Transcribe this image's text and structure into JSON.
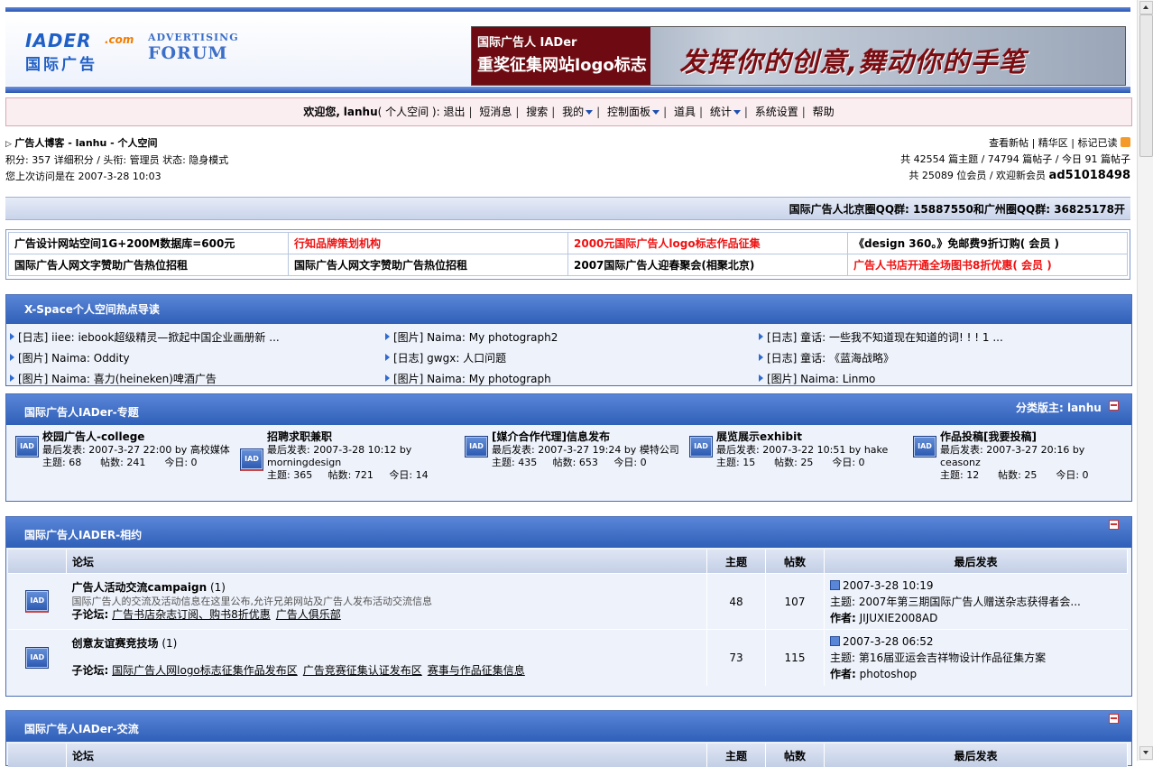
{
  "header": {
    "logo_text": "IADER",
    "logo_dotcom": ".com",
    "logo_cn": "国际广告",
    "tag_a": "ADVERTISING",
    "tag_b": "FORUM",
    "banner_t1": "国际广告人 IADer",
    "banner_t2": "重奖征集网站logo标志",
    "banner_slogan": "发挥你的创意,舞动你的手笔"
  },
  "nav": {
    "welcome": "欢迎您,",
    "user": "lanhu",
    "space": "( 个人空间 ):",
    "items": [
      "退出",
      "短消息",
      "搜索",
      "我的",
      "控制面板",
      "道具",
      "统计",
      "系统设置",
      "帮助"
    ]
  },
  "info": {
    "breadcrumb": "广告人博客 - lanhu  - 个人空间",
    "line2": "积分: 357 详细积分 / 头衔: 管理员 状态: 隐身模式",
    "line3": "您上次访问是在 2007-3-28 10:03",
    "right1_links": [
      "查看新帖",
      "精华区",
      "标记已读"
    ],
    "right2": "共 42554 篇主题 / 74794 篇帖子 / 今日 91 篇帖子",
    "right3_prefix": "共 25089 位会员 / 欢迎新会员",
    "right3_member": "ad51018498"
  },
  "qq": "国际广告人北京圈QQ群: 15887550和广州圈QQ群: 36825178开",
  "ads": [
    [
      "广告设计网站空间1G+200M数据库=600元",
      "行知品牌策划机构",
      "2000元国际广告人logo标志作品征集",
      "《design 360。》免邮费9折订购( 会员 )"
    ],
    [
      "国际广告人网文字赞助广告热位招租",
      "国际广告人网文字赞助广告热位招租",
      "2007国际广告人迎春聚会(相聚北京)",
      "广告人书店开通全场图书8折优惠( 会员 )"
    ]
  ],
  "ads_red": [
    [
      false,
      true,
      true,
      false
    ],
    [
      false,
      false,
      false,
      true
    ]
  ],
  "xspace": {
    "title": "X-Space个人空间热点导读",
    "items": [
      "[日志] iiee: iebook超级精灵—掀起中国企业画册新 ...",
      "[图片] Naima: My photograph2",
      "[日志] 童话: 一些我不知道现在知道的词! ! ! 1 ...",
      "[图片] Naima: Oddity",
      "[日志] gwgx: 人口问题",
      "[日志] 童话: 《蓝海战略》",
      "[图片] Naima: 喜力(heineken)啤酒广告",
      "[图片] Naima: My photograph",
      "[图片] Naima: Linmo"
    ]
  },
  "cat1": {
    "title": "国际广告人IADer-专题",
    "moderator_label": "分类版主:",
    "moderator": "lanhu",
    "forums": [
      {
        "name": "校园广告人-college",
        "last": "最后发表: 2007-3-27 22:00 by 高校媒体",
        "stats": "主题: 68      帖数: 241      今日: 0"
      },
      {
        "name": "招聘求职兼职",
        "last": "最后发表: 2007-3-28 10:12 by morningdesign",
        "stats": "主题: 365     帖数: 721     今日: 14"
      },
      {
        "name": "[媒介合作代理]信息发布",
        "last": "最后发表: 2007-3-27 19:24 by 模特公司",
        "stats": "主题: 435     帖数: 653     今日: 0"
      },
      {
        "name": "展览展示exhibit",
        "last": "最后发表: 2007-3-22 10:51 by hake",
        "stats": "主题: 15      帖数: 25      今日: 0"
      },
      {
        "name": "作品投稿[我要投稿]",
        "last": "最后发表: 2007-3-27 20:16 by ceasonz",
        "stats": "主题: 12      帖数: 25      今日: 0"
      }
    ]
  },
  "cat2": {
    "title": "国际广告人IADER-相约",
    "cols": [
      "论坛",
      "主题",
      "帖数",
      "最后发表"
    ],
    "rows": [
      {
        "name": "广告人活动交流campaign",
        "count": "(1)",
        "desc": "国际广告人的交流及活动信息在这里公布,允许兄弟网站及广告人发布活动交流信息",
        "sub_label": "子论坛:",
        "subs": [
          "广告书店杂志订阅、购书8折优惠",
          "广告人俱乐部"
        ],
        "topics": "48",
        "posts": "107",
        "last_date": "2007-3-28 10:19",
        "last_topic": "主题: 2007年第三期国际广告人赠送杂志获得者会...",
        "last_author_label": "作者:",
        "last_author": "JIJUXIE2008AD"
      },
      {
        "name": "创意友谊赛竞技场",
        "count": "(1)",
        "desc": "",
        "sub_label": "子论坛:",
        "subs": [
          "国际广告人网logo标志征集作品发布区",
          "广告竞赛征集认证发布区",
          "赛事与作品征集信息"
        ],
        "topics": "73",
        "posts": "115",
        "last_date": "2007-3-28 06:52",
        "last_topic": "主题: 第16届亚运会吉祥物设计作品征集方案",
        "last_author_label": "作者:",
        "last_author": "photoshop"
      }
    ]
  },
  "cat3": {
    "title": "国际广告人IADer-交流",
    "cols": [
      "论坛",
      "主题",
      "帖数",
      "最后发表"
    ]
  },
  "icon_label": "IAD"
}
